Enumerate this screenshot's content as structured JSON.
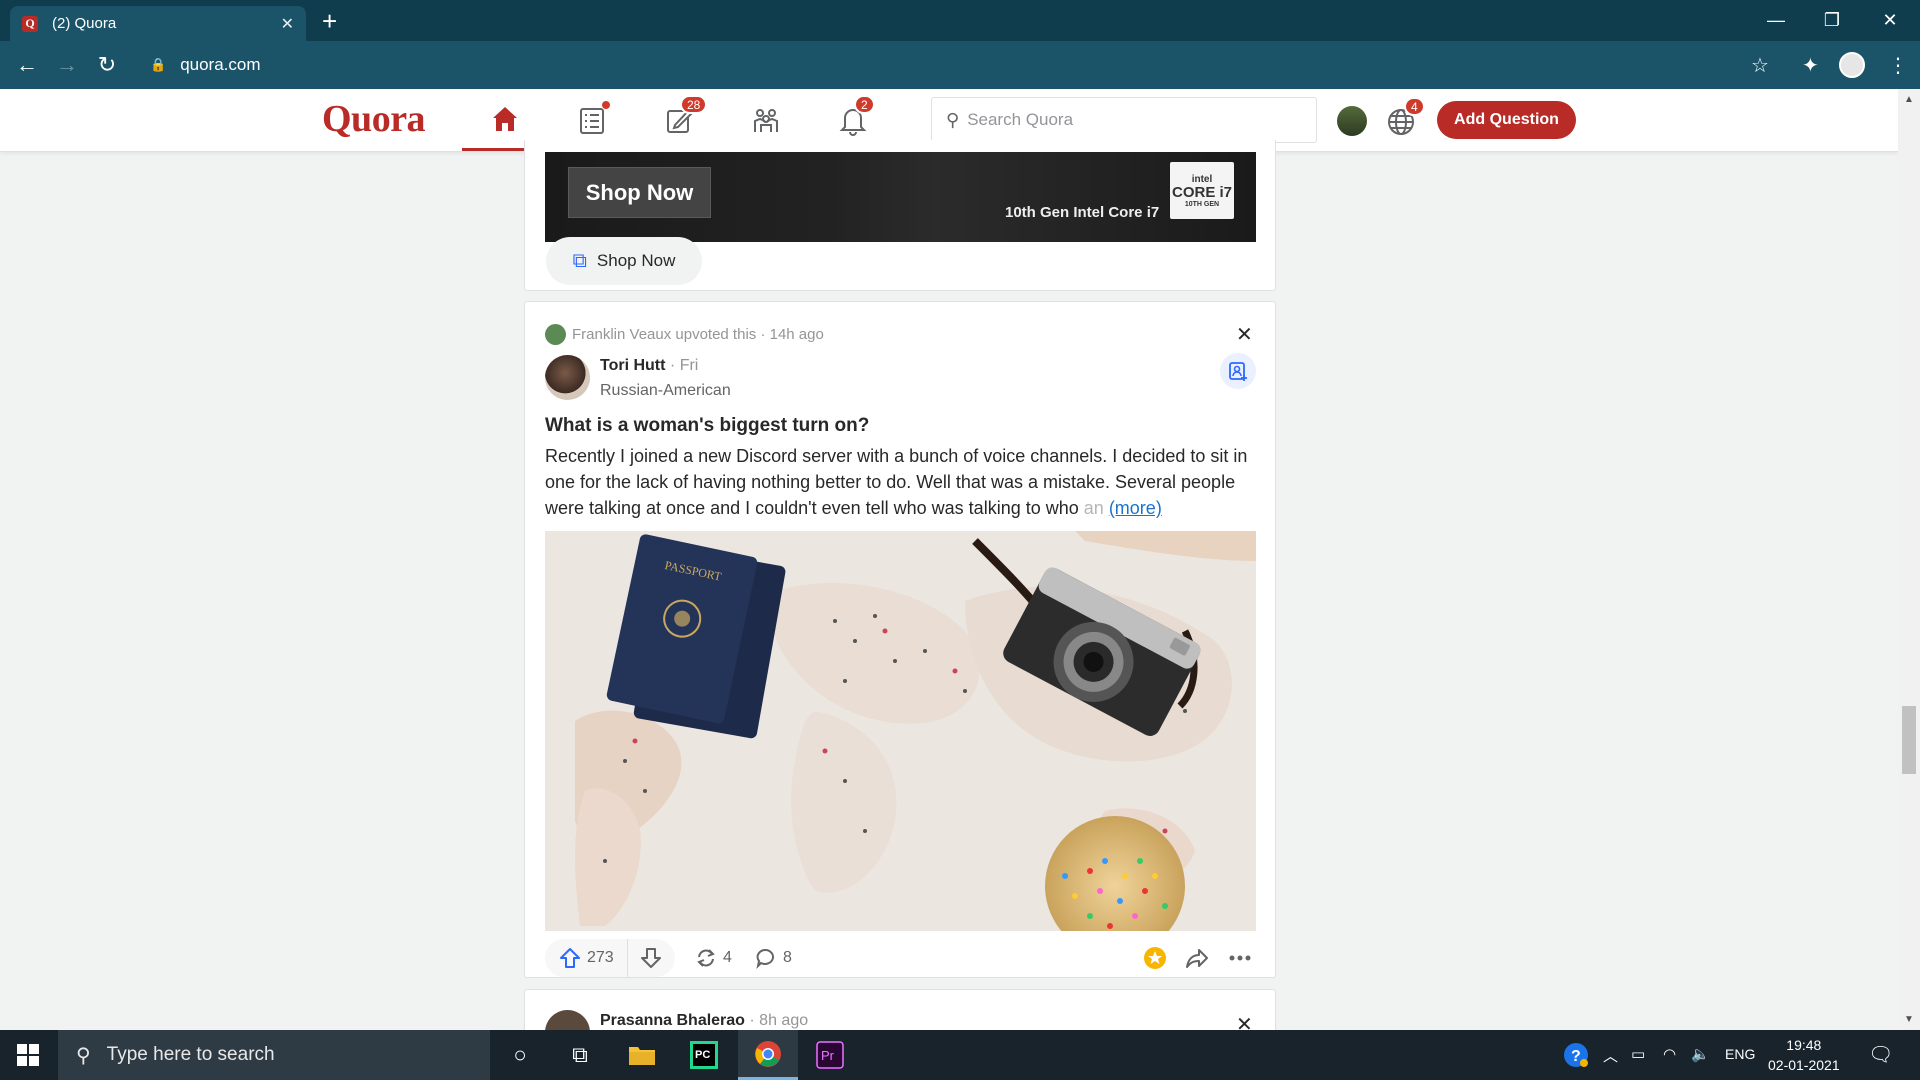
{
  "browser": {
    "tab_title": "(2) Quora",
    "url": "quora.com"
  },
  "quora": {
    "logo": "Quora",
    "badges": {
      "answer": "28",
      "notifications": "2",
      "languages": "4"
    },
    "search_placeholder": "Search Quora",
    "add_question": "Add Question"
  },
  "ad": {
    "banner_button": "Shop Now",
    "banner_text": "10th Gen Intel Core i7",
    "intel_brand": "intel",
    "intel_model": "CORE i7",
    "intel_gen": "10TH GEN",
    "link_label": "Shop Now"
  },
  "post": {
    "upvoted_by": "Franklin Veaux upvoted this · 14h ago",
    "author": "Tori Hutt",
    "author_time": " · Fri",
    "credential": "Russian-American",
    "title": "What is a woman's biggest turn on?",
    "body_main": "Recently I joined a new Discord server with a bunch of voice channels. I decided to sit in one for the lack of having nothing better to do. Well that was a mistake. Several people were talking at once and I couldn't even tell who was talking to who ",
    "body_fade": "an",
    "more": "(more)",
    "passport_text": "PASSPORT",
    "upvotes": "273",
    "shares": "4",
    "comments": "8"
  },
  "next_post": {
    "author": "Prasanna Bhalerao",
    "time": " · 8h ago"
  },
  "taskbar": {
    "search_placeholder": "Type here to search",
    "lang": "ENG",
    "time": "19:48",
    "date": "02-01-2021"
  },
  "colors": {
    "quora_red": "#b92b27",
    "link_blue": "#2e69ff",
    "chrome_dark": "#0f3d4e",
    "chrome_bar": "#1b5468",
    "taskbar": "#18232b"
  }
}
